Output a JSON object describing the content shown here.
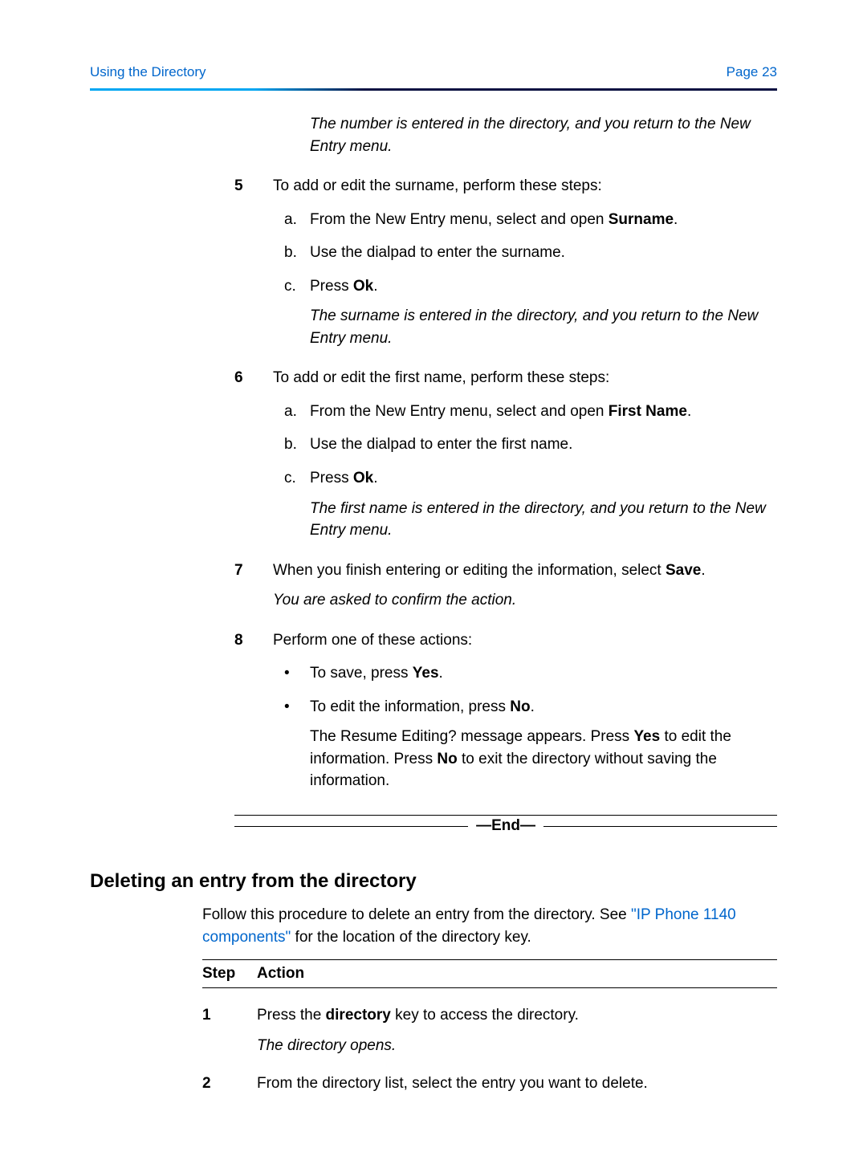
{
  "header": {
    "left": "Using the Directory",
    "right": "Page 23"
  },
  "cont": {
    "italic": "The number is entered in the directory, and you return to the New Entry menu."
  },
  "steps": [
    {
      "num": "5",
      "lead": "To add or edit the surname, perform these steps:",
      "subs": [
        {
          "mark": "a.",
          "pre": "From the New Entry menu, select and open ",
          "bold": "Surname",
          "post": "."
        },
        {
          "mark": "b.",
          "pre": "Use the dialpad to enter the surname.",
          "bold": "",
          "post": ""
        },
        {
          "mark": "c.",
          "pre": "Press ",
          "bold": "Ok",
          "post": "."
        }
      ],
      "result": "The surname is entered in the directory, and you return to the New Entry menu."
    },
    {
      "num": "6",
      "lead": "To add or edit the first name, perform these steps:",
      "subs": [
        {
          "mark": "a.",
          "pre": "From the New Entry menu, select and open ",
          "bold": "First Name",
          "post": "."
        },
        {
          "mark": "b.",
          "pre": "Use the dialpad to enter the first name.",
          "bold": "",
          "post": ""
        },
        {
          "mark": "c.",
          "pre": "Press ",
          "bold": "Ok",
          "post": "."
        }
      ],
      "result": "The first name is entered in the directory, and you return to the New Entry menu."
    },
    {
      "num": "7",
      "lead_pre": "When you finish entering or editing the information, select ",
      "lead_bold": "Save",
      "lead_post": ".",
      "after_italic": "You are asked to confirm the action."
    },
    {
      "num": "8",
      "lead": "Perform one of these actions:",
      "bullets": [
        {
          "pre": "To save, press ",
          "bold": "Yes",
          "post": "."
        },
        {
          "pre": "To edit the information, press ",
          "bold": "No",
          "post": "."
        }
      ],
      "follow": {
        "pre": "The Resume Editing? message appears. Press ",
        "b1": "Yes",
        "mid": " to edit the information. Press ",
        "b2": "No",
        "post": " to exit the directory without saving the information."
      }
    }
  ],
  "endLabel": "—End—",
  "section_title": "Deleting an entry from the directory",
  "intro": {
    "pre": "Follow this procedure to delete an entry from the directory. See ",
    "link": "\"IP Phone 1140 components\"",
    "post": " for the location of the directory key."
  },
  "table": {
    "h1": "Step",
    "h2": "Action",
    "rows": [
      {
        "n": "1",
        "l1_pre": "Press the ",
        "l1_bold": "directory",
        "l1_post": " key to access the directory.",
        "l2_italic": "The directory opens."
      },
      {
        "n": "2",
        "l1_plain": "From the directory list, select the entry you want to delete."
      }
    ]
  }
}
